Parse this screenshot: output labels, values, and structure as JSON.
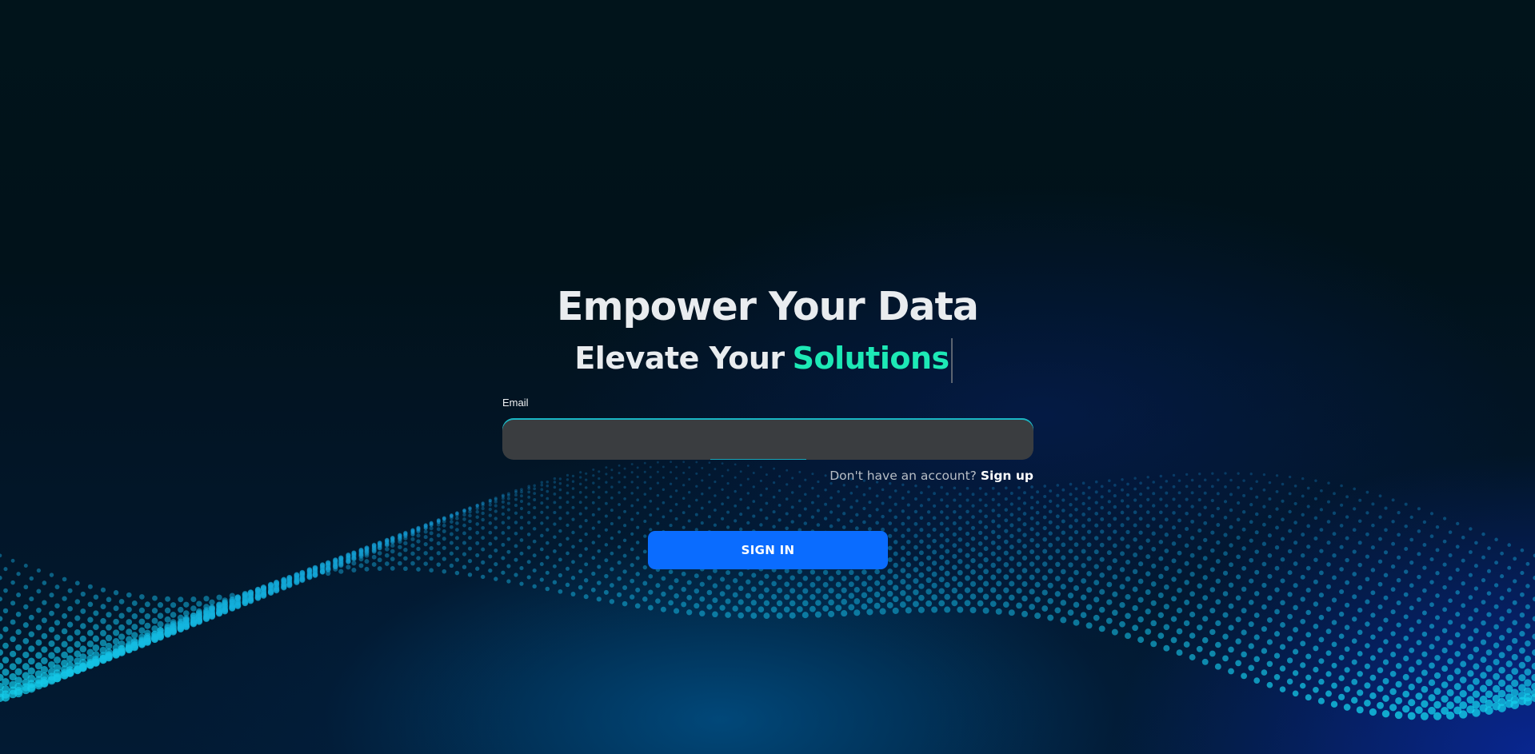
{
  "hero": {
    "line1": "Empower Your Data",
    "line2_prefix": "Elevate Your",
    "line2_accent": "Solutions"
  },
  "form": {
    "email_label": "Email",
    "email_value": "",
    "email_placeholder": "",
    "signup_prompt": "Don't have an account?",
    "signup_link": "Sign up",
    "signin_label": "SIGN IN"
  },
  "colors": {
    "background": "#01121a",
    "accent_text": "#1de9b6",
    "primary_button": "#0a6cff",
    "input_background": "#3a3d40",
    "input_border_glow": "#19b6c4",
    "particle_wave": "#1e8fd8"
  }
}
